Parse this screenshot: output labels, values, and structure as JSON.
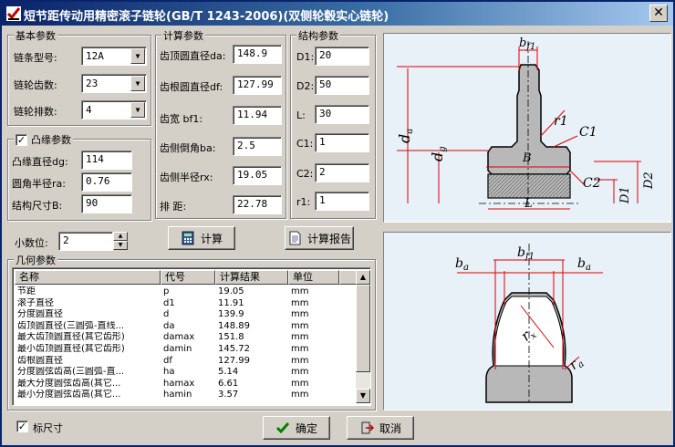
{
  "window": {
    "title": "短节距传动用精密滚子链轮(GB/T 1243-2006)(双侧轮毂实心链轮)",
    "close_label": "✕"
  },
  "basic": {
    "legend": "基本参数",
    "rows": [
      {
        "label": "链条型号:",
        "value": "12A"
      },
      {
        "label": "链轮齿数:",
        "value": "23"
      },
      {
        "label": "链轮排数:",
        "value": "4"
      }
    ]
  },
  "flange": {
    "legend": "凸缘参数",
    "checked": true,
    "rows": [
      {
        "label": "凸缘直径dg:",
        "value": "114"
      },
      {
        "label": "圆角半径ra:",
        "value": "0.76"
      },
      {
        "label": "结构尺寸B:",
        "value": "90"
      }
    ]
  },
  "calc": {
    "legend": "计算参数",
    "rows": [
      {
        "label": "齿顶圆直径da:",
        "value": "148.9"
      },
      {
        "label": "齿根圆直径df:",
        "value": "127.99"
      },
      {
        "label": "齿宽 bf1:",
        "value": "11.94"
      },
      {
        "label": "齿侧倒角ba:",
        "value": "2.5"
      },
      {
        "label": "齿侧半径rx:",
        "value": "19.05"
      },
      {
        "label": "排    距:",
        "value": "22.78"
      }
    ]
  },
  "struct": {
    "legend": "结构参数",
    "rows": [
      {
        "label": "D1:",
        "value": "20"
      },
      {
        "label": "D2:",
        "value": "50"
      },
      {
        "label": "L:",
        "value": "30"
      },
      {
        "label": "C1:",
        "value": "1"
      },
      {
        "label": "C2:",
        "value": "2"
      },
      {
        "label": "r1:",
        "value": "1"
      }
    ]
  },
  "decimals": {
    "label": "小数位:",
    "value": "2"
  },
  "buttons": {
    "calc": "计算",
    "report": "计算报告",
    "ok": "确定",
    "cancel": "取消"
  },
  "geometry": {
    "legend": "几何参数",
    "headers": [
      "名称",
      "代号",
      "计算结果",
      "单位"
    ],
    "rows": [
      [
        "节距",
        "p",
        "19.05",
        "mm"
      ],
      [
        "滚子直径",
        "d1",
        "11.91",
        "mm"
      ],
      [
        "分度圆直径",
        "d",
        "139.9",
        "mm"
      ],
      [
        "齿顶圆直径(三圆弧-直线...",
        "da",
        "148.89",
        "mm"
      ],
      [
        "最大齿顶圆直径(其它齿形)",
        "damax",
        "151.8",
        "mm"
      ],
      [
        "最小齿顶圆直径(其它齿形)",
        "damin",
        "145.72",
        "mm"
      ],
      [
        "齿根圆直径",
        "df",
        "127.99",
        "mm"
      ],
      [
        "分度圆弦齿高(三圆弧-直...",
        "ha",
        "5.14",
        "mm"
      ],
      [
        "最大分度圆弦齿高(其它...",
        "hamax",
        "6.61",
        "mm"
      ],
      [
        "最小分度圆弦齿高(其它...",
        "hamin",
        "3.57",
        "mm"
      ]
    ]
  },
  "mark_size": {
    "label": "标尺寸",
    "checked": true
  },
  "figure1": {
    "labels": [
      "bf1",
      "r1",
      "C1",
      "da",
      "dg",
      "B",
      "C2",
      "L",
      "D1",
      "D2"
    ]
  },
  "figure2": {
    "labels": [
      "bf1",
      "ba",
      "ba",
      "rx",
      "ra"
    ]
  },
  "colors": {
    "dim": "#e00000",
    "part": "#b8b8b8",
    "panel_bg": "#e8f0f8"
  }
}
